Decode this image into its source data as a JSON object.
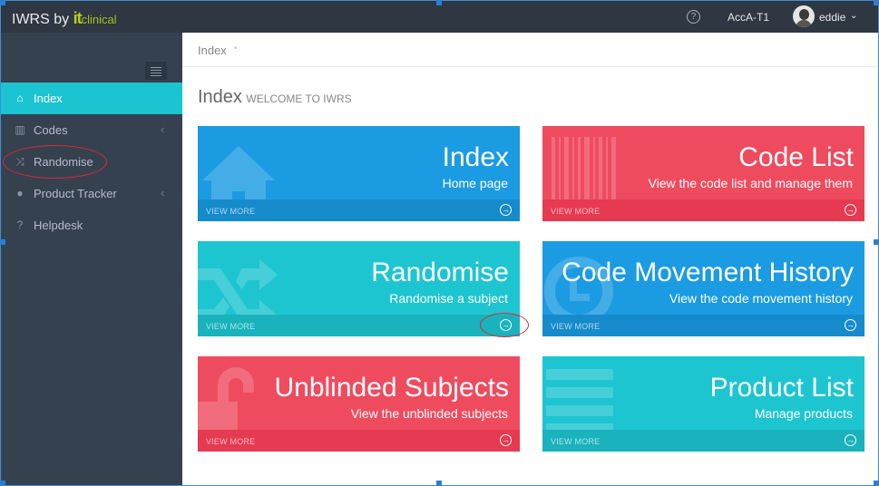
{
  "header": {
    "brand_text": "IWRS by ",
    "brand_it": "it",
    "brand_clinical": "clinical",
    "help_icon": "question-circle-icon",
    "account": "AccA-T1",
    "user": "eddie",
    "caret": "⌄"
  },
  "sidebar": {
    "items": [
      {
        "label": "Index",
        "icon": "home-icon",
        "glyph": "⌂",
        "active": true,
        "chevron": ""
      },
      {
        "label": "Codes",
        "icon": "barcode-icon",
        "glyph": "▥",
        "active": false,
        "chevron": "‹"
      },
      {
        "label": "Randomise",
        "icon": "shuffle-icon",
        "glyph": "⤨",
        "active": false,
        "chevron": ""
      },
      {
        "label": "Product Tracker",
        "icon": "map-marker-icon",
        "glyph": "●",
        "active": false,
        "chevron": "‹"
      },
      {
        "label": "Helpdesk",
        "icon": "question-icon",
        "glyph": "?",
        "active": false,
        "chevron": ""
      }
    ]
  },
  "breadcrumb": {
    "current": "Index",
    "separator": "•"
  },
  "page_title": {
    "title": "Index",
    "subtitle": "WELCOME TO IWRS"
  },
  "tiles": [
    {
      "title": "Index",
      "subtitle": "Home page",
      "more": "VIEW MORE",
      "color": "blue",
      "icon": "home-icon"
    },
    {
      "title": "Code List",
      "subtitle": "View the code list and manage them",
      "more": "VIEW MORE",
      "color": "red",
      "icon": "barcode-icon"
    },
    {
      "title": "Randomise",
      "subtitle": "Randomise a subject",
      "more": "VIEW MORE",
      "color": "teal",
      "icon": "shuffle-icon"
    },
    {
      "title": "Code Movement History",
      "subtitle": "View the code movement history",
      "more": "VIEW MORE",
      "color": "blue",
      "icon": "history-icon"
    },
    {
      "title": "Unblinded Subjects",
      "subtitle": "View the unblinded subjects",
      "more": "VIEW MORE",
      "color": "red",
      "icon": "unlock-icon"
    },
    {
      "title": "Product List",
      "subtitle": "Manage products",
      "more": "VIEW MORE",
      "color": "teal",
      "icon": "list-icon"
    }
  ],
  "arrow_glyph": "→",
  "colors": {
    "blue": "#1b9be2",
    "red": "#ef4b5f",
    "teal": "#1dc5d0",
    "sidebar": "#364150",
    "header": "#2f3742"
  }
}
